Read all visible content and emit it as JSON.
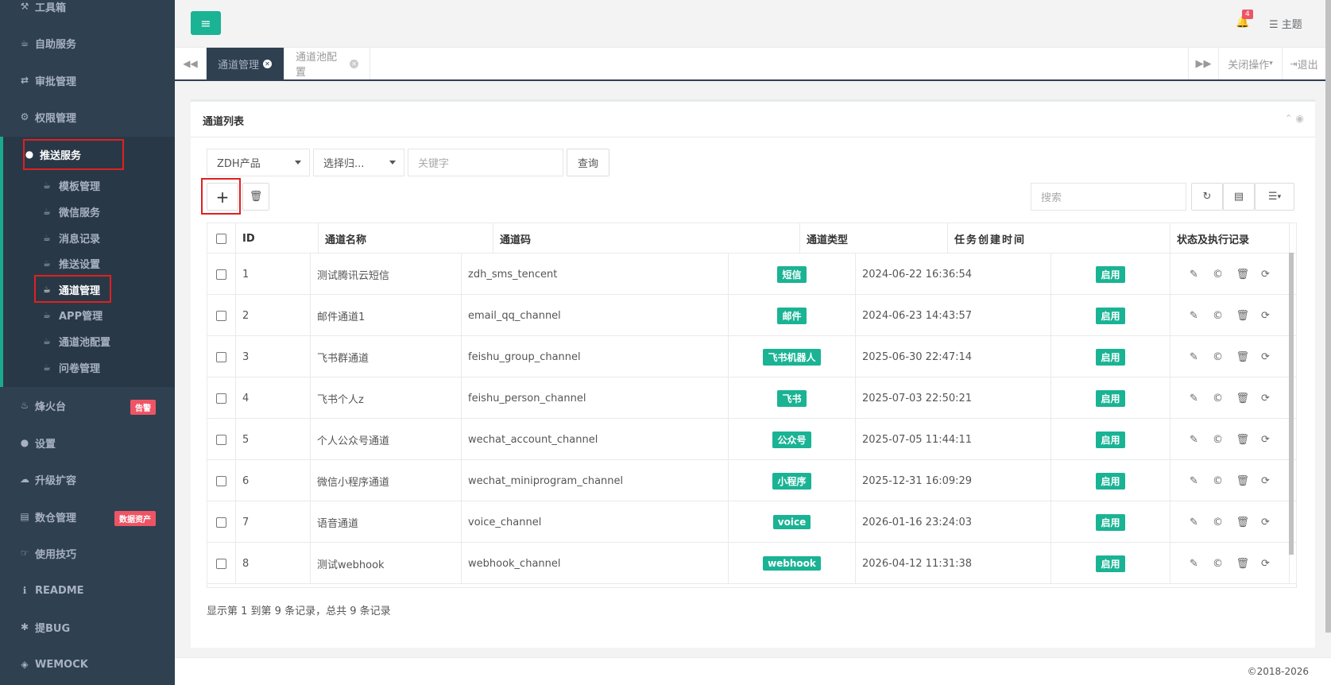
{
  "sidebar": {
    "items": [
      {
        "label": "工具箱",
        "icon": "wrench-icon"
      },
      {
        "label": "自助服务",
        "icon": "coffee-icon"
      },
      {
        "label": "审批管理",
        "icon": "exchange-icon"
      },
      {
        "label": "权限管理",
        "icon": "gear-icon"
      },
      {
        "label": "推送服务",
        "icon": "comment-icon"
      },
      {
        "label": "烽火台",
        "icon": "fire-icon",
        "badge": "告警"
      },
      {
        "label": "设置",
        "icon": "user-icon"
      },
      {
        "label": "升级扩容",
        "icon": "cloud-icon"
      },
      {
        "label": "数仓管理",
        "icon": "database-icon",
        "badge": "数据资产"
      },
      {
        "label": "使用技巧",
        "icon": "hand-icon"
      },
      {
        "label": "README",
        "icon": "info-icon"
      },
      {
        "label": "提BUG",
        "icon": "bug-icon"
      },
      {
        "label": "WEMOCK",
        "icon": "cube-icon"
      }
    ],
    "sub_items": [
      {
        "label": "模板管理"
      },
      {
        "label": "微信服务"
      },
      {
        "label": "消息记录"
      },
      {
        "label": "推送设置"
      },
      {
        "label": "通道管理"
      },
      {
        "label": "APP管理"
      },
      {
        "label": "通道池配置"
      },
      {
        "label": "问卷管理"
      }
    ]
  },
  "topbar": {
    "bell_count": "4",
    "theme_label": "主题"
  },
  "tabs": {
    "items": [
      {
        "label": "通道管理"
      },
      {
        "label": "通道池配置"
      }
    ],
    "close_ops": "关闭操作",
    "logout": "退出"
  },
  "panel": {
    "title": "通道列表"
  },
  "filters": {
    "product": "ZDH产品",
    "group": "选择归...",
    "keyword_placeholder": "关键字",
    "query_label": "查询",
    "search_placeholder": "搜索"
  },
  "table": {
    "headers": [
      "ID",
      "通道名称",
      "通道码",
      "通道类型",
      "任务创建时间",
      "状态及执行记录"
    ],
    "rows": [
      {
        "id": "1",
        "name": "测试腾讯云短信",
        "code": "zdh_sms_tencent",
        "type": "短信",
        "time": "2024-06-22 16:36:54",
        "status": "启用"
      },
      {
        "id": "2",
        "name": "邮件通道1",
        "code": "email_qq_channel",
        "type": "邮件",
        "time": "2024-06-23 14:43:57",
        "status": "启用"
      },
      {
        "id": "3",
        "name": "飞书群通道",
        "code": "feishu_group_channel",
        "type": "飞书机器人",
        "time": "2025-06-30 22:47:14",
        "status": "启用"
      },
      {
        "id": "4",
        "name": "飞书个人z",
        "code": "feishu_person_channel",
        "type": "飞书",
        "time": "2025-07-03 22:50:21",
        "status": "启用"
      },
      {
        "id": "5",
        "name": "个人公众号通道",
        "code": "wechat_account_channel",
        "type": "公众号",
        "time": "2025-07-05 11:44:11",
        "status": "启用"
      },
      {
        "id": "6",
        "name": "微信小程序通道",
        "code": "wechat_miniprogram_channel",
        "type": "小程序",
        "time": "2025-12-31 16:09:29",
        "status": "启用"
      },
      {
        "id": "7",
        "name": "语音通道",
        "code": "voice_channel",
        "type": "voice",
        "time": "2026-01-16 23:24:03",
        "status": "启用"
      },
      {
        "id": "8",
        "name": "测试webhook",
        "code": "webhook_channel",
        "type": "webhook",
        "time": "2026-04-12 11:31:38",
        "status": "启用"
      }
    ]
  },
  "pager": {
    "info": "显示第 1 到第 9 条记录，总共 9 条记录"
  },
  "footer": {
    "copyright": "©2018-2026"
  },
  "colors": {
    "sidebar_bg": "#2f4050",
    "accent": "#1ab394",
    "highlight": "#e02020"
  }
}
